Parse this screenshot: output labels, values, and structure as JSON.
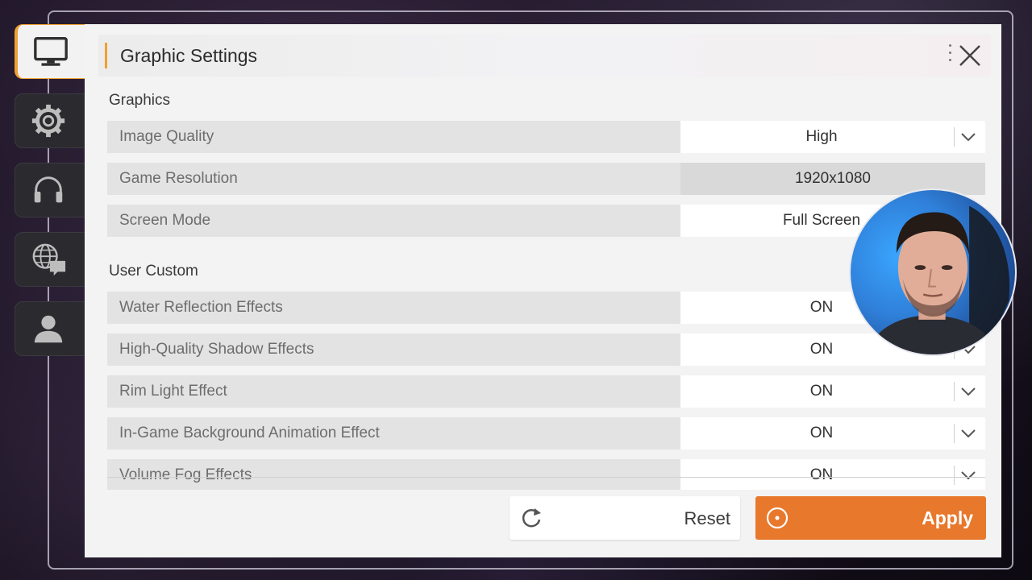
{
  "panel": {
    "title": "Graphic Settings"
  },
  "nav": {
    "tabs": [
      {
        "icon": "monitor-icon",
        "active": true
      },
      {
        "icon": "gear-icon",
        "active": false
      },
      {
        "icon": "headphones-icon",
        "active": false
      },
      {
        "icon": "globe-chat-icon",
        "active": false
      },
      {
        "icon": "user-icon",
        "active": false
      }
    ]
  },
  "sections": {
    "graphics": "Graphics",
    "user_custom": "User Custom"
  },
  "rows": {
    "image_quality": {
      "label": "Image Quality",
      "value": "High"
    },
    "game_resolution": {
      "label": "Game Resolution",
      "value": "1920x1080"
    },
    "screen_mode": {
      "label": "Screen Mode",
      "value": "Full Screen"
    },
    "water_reflection": {
      "label": "Water Reflection Effects",
      "value": "ON"
    },
    "shadow": {
      "label": "High-Quality Shadow Effects",
      "value": "ON"
    },
    "rim_light": {
      "label": "Rim Light Effect",
      "value": "ON"
    },
    "background_anim": {
      "label": "In-Game Background Animation Effect",
      "value": "ON"
    },
    "volume_fog": {
      "label": "Volume Fog Effects",
      "value": "ON"
    }
  },
  "buttons": {
    "reset": "Reset",
    "apply": "Apply"
  },
  "colors": {
    "accent": "#f0a030",
    "apply": "#e8782c"
  }
}
